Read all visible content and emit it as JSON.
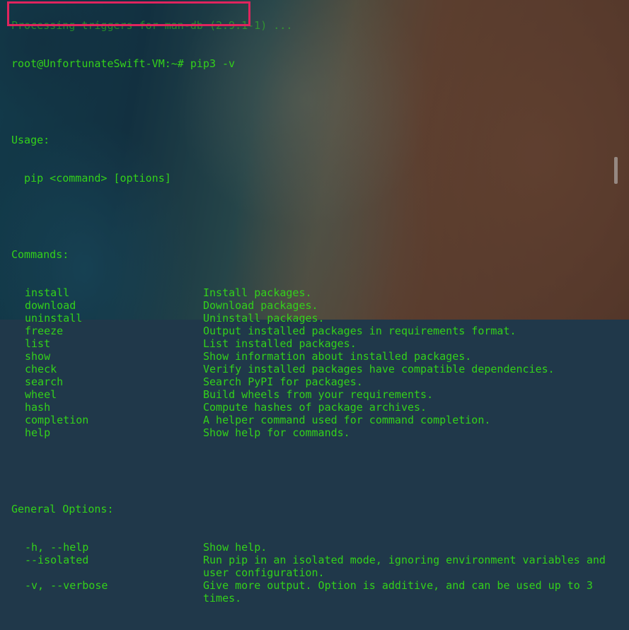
{
  "terminal": {
    "partial_top_line": "Processing triggers for man-db (2.9.1-1) ...",
    "prompt": "root@UnfortunateSwift-VM:~# pip3 -v",
    "usage_header": "Usage:",
    "usage_line": "  pip <command> [options]",
    "commands_header": "Commands:",
    "commands": [
      {
        "name": "install",
        "desc": "Install packages."
      },
      {
        "name": "download",
        "desc": "Download packages."
      },
      {
        "name": "uninstall",
        "desc": "Uninstall packages."
      },
      {
        "name": "freeze",
        "desc": "Output installed packages in requirements format."
      },
      {
        "name": "list",
        "desc": "List installed packages."
      },
      {
        "name": "show",
        "desc": "Show information about installed packages."
      },
      {
        "name": "check",
        "desc": "Verify installed packages have compatible dependencies."
      },
      {
        "name": "search",
        "desc": "Search PyPI for packages."
      },
      {
        "name": "wheel",
        "desc": "Build wheels from your requirements."
      },
      {
        "name": "hash",
        "desc": "Compute hashes of package archives."
      },
      {
        "name": "completion",
        "desc": "A helper command used for command completion."
      },
      {
        "name": "help",
        "desc": "Show help for commands."
      }
    ],
    "general_header": "General Options:",
    "options": [
      {
        "name": "-h, --help",
        "desc": "Show help."
      },
      {
        "name": "--isolated",
        "desc": "Run pip in an isolated mode, ignoring environment variables and"
      },
      {
        "name": "",
        "desc": "user configuration."
      },
      {
        "name": "-v, --verbose",
        "desc": "Give more output. Option is additive, and can be used up to 3"
      },
      {
        "name": "",
        "desc": "times."
      }
    ]
  },
  "colors": {
    "text": "#33d11a",
    "highlight_box": "#e0245e"
  }
}
